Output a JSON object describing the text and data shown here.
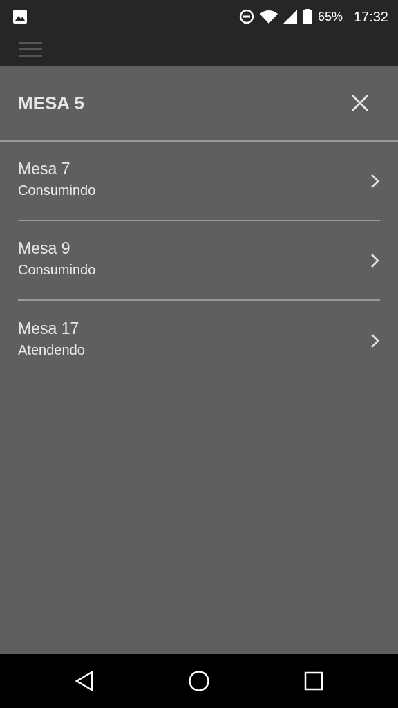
{
  "status_bar": {
    "battery": "65%",
    "time": "17:32"
  },
  "dialog": {
    "title": "MESA 5",
    "items": [
      {
        "name": "Mesa 7",
        "status": "Consumindo"
      },
      {
        "name": "Mesa 9",
        "status": "Consumindo"
      },
      {
        "name": "Mesa 17",
        "status": "Atendendo"
      }
    ]
  }
}
